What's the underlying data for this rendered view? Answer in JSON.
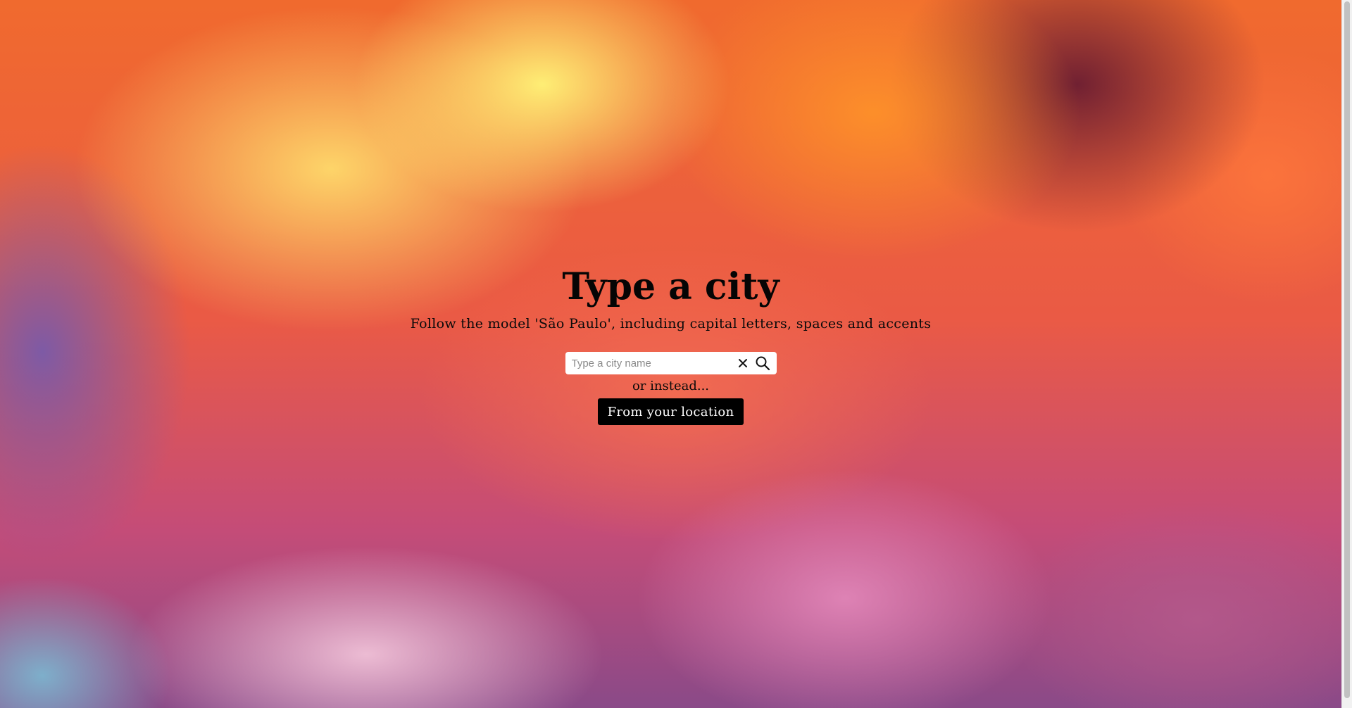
{
  "page": {
    "title": "Type a city",
    "subtitle": "Follow the model 'São Paulo', including capital letters, spaces and accents"
  },
  "search": {
    "value": "",
    "placeholder": "Type a city name",
    "clear_icon": "close-icon",
    "search_icon": "search-icon"
  },
  "alternative": {
    "text": "or instead...",
    "location_button_label": "From your location"
  },
  "colors": {
    "button_bg": "#000000",
    "button_text": "#ffffff",
    "title_text": "#050505",
    "input_bg": "#ffffff"
  }
}
